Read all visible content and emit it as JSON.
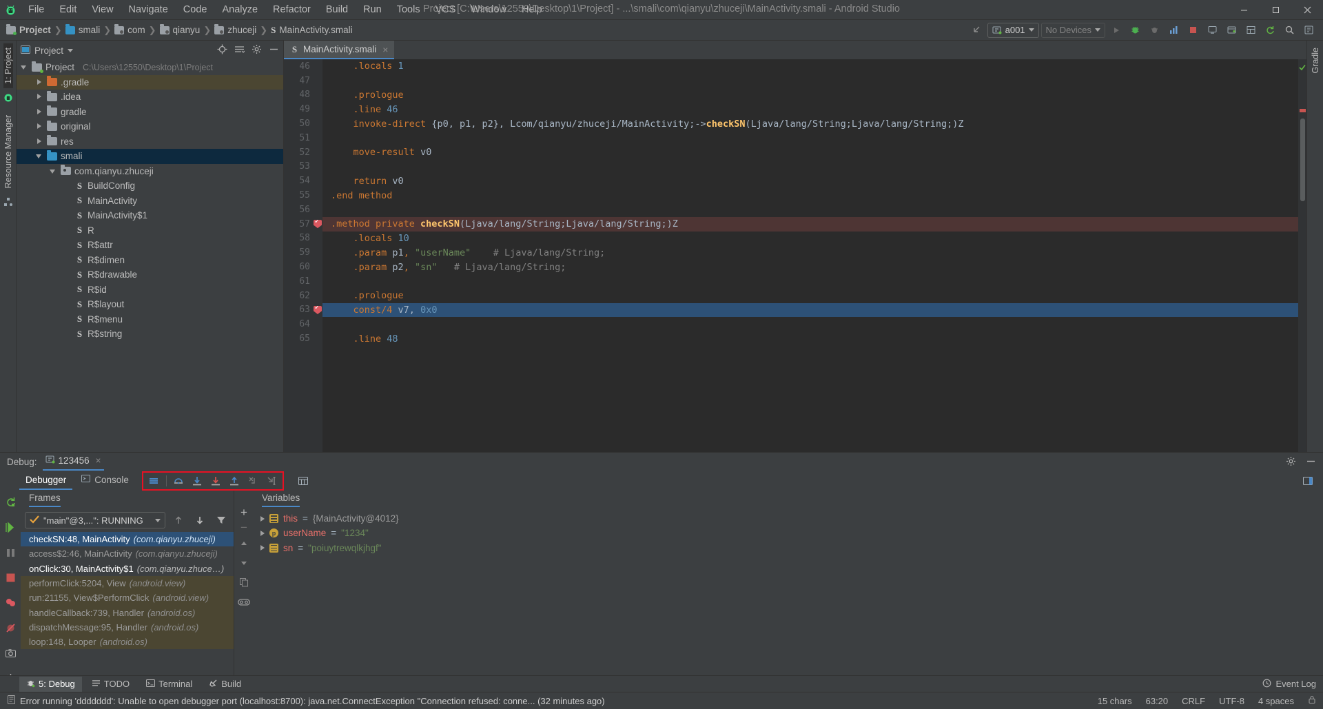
{
  "window": {
    "title": "Project [C:\\Users\\12550\\Desktop\\1\\Project] - ...\\smali\\com\\qianyu\\zhuceji\\MainActivity.smali - Android Studio",
    "minimize_label": "–",
    "maximize_label": "❐",
    "close_label": "✕"
  },
  "menu": [
    {
      "label": "File"
    },
    {
      "label": "Edit"
    },
    {
      "label": "View"
    },
    {
      "label": "Navigate"
    },
    {
      "label": "Code"
    },
    {
      "label": "Analyze"
    },
    {
      "label": "Refactor"
    },
    {
      "label": "Build"
    },
    {
      "label": "Run"
    },
    {
      "label": "Tools"
    },
    {
      "label": "VCS"
    },
    {
      "label": "Window"
    },
    {
      "label": "Help"
    }
  ],
  "breadcrumb": [
    {
      "label": "Project",
      "icon": "folder-module-icon"
    },
    {
      "label": "smali",
      "icon": "folder-blue-icon"
    },
    {
      "label": "com",
      "icon": "folder-package-icon"
    },
    {
      "label": "qianyu",
      "icon": "folder-package-icon"
    },
    {
      "label": "zhuceji",
      "icon": "folder-package-icon"
    },
    {
      "label": "MainActivity.smali",
      "icon": "smali-file-icon"
    }
  ],
  "toolbar": {
    "run_config": "a001",
    "device": "No Devices",
    "back_icon": "back-arrow-icon",
    "run_icon": "run-icon",
    "debug_icon": "debug-icon",
    "attach_icon": "attach-debugger-icon",
    "profile_icon": "profile-icon",
    "stop_icon": "stop-icon",
    "avd_icon": "avd-manager-icon",
    "sdk_icon": "sdk-manager-icon",
    "layout_icon": "layout-inspector-icon",
    "sync_icon": "sync-gradle-icon",
    "search_icon": "search-icon",
    "settings_icon": "settings-icon"
  },
  "left_rail": [
    {
      "label": "1: Project",
      "selected": true
    },
    {
      "label": "Resource Manager",
      "selected": false
    }
  ],
  "project_panel": {
    "header_title": "Project",
    "locate_icon": "locate-icon",
    "collapse_icon": "collapse-all-icon",
    "settings_icon": "gear-icon",
    "hide_icon": "hide-icon",
    "tree": [
      {
        "label": "Project",
        "path": "C:\\Users\\12550\\Desktop\\1\\Project",
        "indent": 0,
        "arrow": "down",
        "icon": "folder-module-icon",
        "state": "normal"
      },
      {
        "label": ".gradle",
        "path": "",
        "indent": 1,
        "arrow": "right",
        "icon": "folder-orange-icon",
        "state": "highlight"
      },
      {
        "label": ".idea",
        "path": "",
        "indent": 1,
        "arrow": "right",
        "icon": "folder-gray-icon",
        "state": "normal"
      },
      {
        "label": "gradle",
        "path": "",
        "indent": 1,
        "arrow": "right",
        "icon": "folder-gray-icon",
        "state": "normal"
      },
      {
        "label": "original",
        "path": "",
        "indent": 1,
        "arrow": "right",
        "icon": "folder-gray-icon",
        "state": "normal"
      },
      {
        "label": "res",
        "path": "",
        "indent": 1,
        "arrow": "right",
        "icon": "folder-gray-icon",
        "state": "normal"
      },
      {
        "label": "smali",
        "path": "",
        "indent": 1,
        "arrow": "down",
        "icon": "folder-blue-icon",
        "state": "selected"
      },
      {
        "label": "com.qianyu.zhuceji",
        "path": "",
        "indent": 2,
        "arrow": "down",
        "icon": "folder-package-icon",
        "state": "normal"
      },
      {
        "label": "BuildConfig",
        "path": "",
        "indent": 3,
        "arrow": "none",
        "icon": "smali-file-icon",
        "state": "normal"
      },
      {
        "label": "MainActivity",
        "path": "",
        "indent": 3,
        "arrow": "none",
        "icon": "smali-file-icon",
        "state": "normal"
      },
      {
        "label": "MainActivity$1",
        "path": "",
        "indent": 3,
        "arrow": "none",
        "icon": "smali-file-icon",
        "state": "normal"
      },
      {
        "label": "R",
        "path": "",
        "indent": 3,
        "arrow": "none",
        "icon": "smali-file-icon",
        "state": "normal"
      },
      {
        "label": "R$attr",
        "path": "",
        "indent": 3,
        "arrow": "none",
        "icon": "smali-file-icon",
        "state": "normal"
      },
      {
        "label": "R$dimen",
        "path": "",
        "indent": 3,
        "arrow": "none",
        "icon": "smali-file-icon",
        "state": "normal"
      },
      {
        "label": "R$drawable",
        "path": "",
        "indent": 3,
        "arrow": "none",
        "icon": "smali-file-icon",
        "state": "normal"
      },
      {
        "label": "R$id",
        "path": "",
        "indent": 3,
        "arrow": "none",
        "icon": "smali-file-icon",
        "state": "normal"
      },
      {
        "label": "R$layout",
        "path": "",
        "indent": 3,
        "arrow": "none",
        "icon": "smali-file-icon",
        "state": "normal"
      },
      {
        "label": "R$menu",
        "path": "",
        "indent": 3,
        "arrow": "none",
        "icon": "smali-file-icon",
        "state": "normal"
      },
      {
        "label": "R$string",
        "path": "",
        "indent": 3,
        "arrow": "none",
        "icon": "smali-file-icon",
        "state": "normal"
      }
    ]
  },
  "editor": {
    "tab_label": "MainActivity.smali",
    "tab_close": "×",
    "lines": [
      {
        "n": "46",
        "bp": false,
        "state": "normal",
        "tokens": [
          {
            "t": "    ",
            "c": "id"
          },
          {
            "t": ".locals ",
            "c": "k"
          },
          {
            "t": "1",
            "c": "num"
          }
        ]
      },
      {
        "n": "47",
        "bp": false,
        "state": "normal",
        "tokens": []
      },
      {
        "n": "48",
        "bp": false,
        "state": "normal",
        "tokens": [
          {
            "t": "    ",
            "c": "id"
          },
          {
            "t": ".prologue",
            "c": "k"
          }
        ]
      },
      {
        "n": "49",
        "bp": false,
        "state": "normal",
        "tokens": [
          {
            "t": "    ",
            "c": "id"
          },
          {
            "t": ".line ",
            "c": "k"
          },
          {
            "t": "46",
            "c": "num"
          }
        ]
      },
      {
        "n": "50",
        "bp": false,
        "state": "normal",
        "tokens": [
          {
            "t": "    ",
            "c": "id"
          },
          {
            "t": "invoke-direct ",
            "c": "k"
          },
          {
            "t": "{p0, p1, p2}, ",
            "c": "id"
          },
          {
            "t": "Lcom/qianyu/zhuceji/MainActivity;->",
            "c": "id"
          },
          {
            "t": "checkSN",
            "c": "mth"
          },
          {
            "t": "(Ljava/lang/String;Ljava/lang/String;)Z",
            "c": "id"
          }
        ]
      },
      {
        "n": "51",
        "bp": false,
        "state": "normal",
        "tokens": []
      },
      {
        "n": "52",
        "bp": false,
        "state": "normal",
        "tokens": [
          {
            "t": "    ",
            "c": "id"
          },
          {
            "t": "move-result ",
            "c": "k"
          },
          {
            "t": "v0",
            "c": "id"
          }
        ]
      },
      {
        "n": "53",
        "bp": false,
        "state": "normal",
        "tokens": []
      },
      {
        "n": "54",
        "bp": false,
        "state": "normal",
        "tokens": [
          {
            "t": "    ",
            "c": "id"
          },
          {
            "t": "return ",
            "c": "k"
          },
          {
            "t": "v0",
            "c": "id"
          }
        ]
      },
      {
        "n": "55",
        "bp": false,
        "state": "normal",
        "tokens": [
          {
            "t": ".end method",
            "c": "k"
          }
        ]
      },
      {
        "n": "56",
        "bp": false,
        "state": "normal",
        "tokens": []
      },
      {
        "n": "57",
        "bp": true,
        "state": "err",
        "tokens": [
          {
            "t": ".method private ",
            "c": "k"
          },
          {
            "t": "checkSN",
            "c": "mth"
          },
          {
            "t": "(Ljava/lang/String;Ljava/lang/String;)Z",
            "c": "id"
          }
        ]
      },
      {
        "n": "58",
        "bp": false,
        "state": "normal",
        "tokens": [
          {
            "t": "    ",
            "c": "id"
          },
          {
            "t": ".locals ",
            "c": "k"
          },
          {
            "t": "10",
            "c": "num"
          }
        ]
      },
      {
        "n": "59",
        "bp": false,
        "state": "normal",
        "tokens": [
          {
            "t": "    ",
            "c": "id"
          },
          {
            "t": ".param ",
            "c": "k"
          },
          {
            "t": "p1",
            "c": "id"
          },
          {
            "t": ", ",
            "c": "k"
          },
          {
            "t": "\"userName\"",
            "c": "str"
          },
          {
            "t": "    # Ljava/lang/String;",
            "c": "cmt"
          }
        ]
      },
      {
        "n": "60",
        "bp": false,
        "state": "normal",
        "tokens": [
          {
            "t": "    ",
            "c": "id"
          },
          {
            "t": ".param ",
            "c": "k"
          },
          {
            "t": "p2",
            "c": "id"
          },
          {
            "t": ", ",
            "c": "k"
          },
          {
            "t": "\"sn\"",
            "c": "str"
          },
          {
            "t": "   # Ljava/lang/String;",
            "c": "cmt"
          }
        ]
      },
      {
        "n": "61",
        "bp": false,
        "state": "normal",
        "tokens": []
      },
      {
        "n": "62",
        "bp": false,
        "state": "normal",
        "tokens": [
          {
            "t": "    ",
            "c": "id"
          },
          {
            "t": ".prologue",
            "c": "k"
          }
        ]
      },
      {
        "n": "63",
        "bp": true,
        "state": "cur",
        "tokens": [
          {
            "t": "    ",
            "c": "id"
          },
          {
            "t": "const/4 ",
            "c": "k"
          },
          {
            "t": "v7, ",
            "c": "id"
          },
          {
            "t": "0x0",
            "c": "num"
          }
        ]
      },
      {
        "n": "64",
        "bp": false,
        "state": "normal",
        "tokens": []
      },
      {
        "n": "65",
        "bp": false,
        "state": "normal",
        "tokens": [
          {
            "t": "    ",
            "c": "id"
          },
          {
            "t": ".line ",
            "c": "k"
          },
          {
            "t": "48",
            "c": "num"
          }
        ]
      }
    ]
  },
  "right_rail": [
    {
      "label": "Gradle"
    }
  ],
  "debug": {
    "title": "Debug:",
    "session_name": "123456",
    "session_close": "×",
    "session_icon": "run-config-icon",
    "settings_icon": "gear-icon",
    "hide_icon": "hide-icon",
    "restore_icon": "restore-layout-icon",
    "rerun_icon": "rerun-icon",
    "tabs": [
      {
        "label": "Debugger",
        "active": true,
        "icon": ""
      },
      {
        "label": "Console",
        "active": false,
        "icon": "console-icon"
      }
    ],
    "step_buttons": [
      {
        "name": "show-execution-point-icon",
        "tip": "Show Execution Point"
      },
      {
        "name": "step-over-icon",
        "tip": "Step Over"
      },
      {
        "name": "step-into-icon",
        "tip": "Step Into"
      },
      {
        "name": "force-step-into-icon",
        "tip": "Force Step Into"
      },
      {
        "name": "step-out-icon",
        "tip": "Step Out"
      },
      {
        "name": "drop-frame-icon",
        "tip": "Drop Frame"
      },
      {
        "name": "run-to-cursor-icon",
        "tip": "Run to Cursor"
      }
    ],
    "evaluate_icon": "evaluate-expression-icon",
    "frames": {
      "tab_label": "Frames",
      "thread": "\"main\"@3,...\": RUNNING",
      "thread_state_icon": "thread-running-icon",
      "up_icon": "frame-up-icon",
      "down_icon": "frame-down-icon",
      "filter_icon": "filter-icon",
      "items": [
        {
          "label": "checkSN:48, MainActivity",
          "pkg": "(com.qianyu.zhuceji)",
          "state": "selected"
        },
        {
          "label": "access$2:46, MainActivity",
          "pkg": "(com.qianyu.zhuceji)",
          "state": "normal"
        },
        {
          "label": "onClick:30, MainActivity$1",
          "pkg": "(com.qianyu.zhuce…)",
          "state": "active"
        },
        {
          "label": "performClick:5204, View",
          "pkg": "(android.view)",
          "state": "lib"
        },
        {
          "label": "run:21155, View$PerformClick",
          "pkg": "(android.view)",
          "state": "lib"
        },
        {
          "label": "handleCallback:739, Handler",
          "pkg": "(android.os)",
          "state": "lib"
        },
        {
          "label": "dispatchMessage:95, Handler",
          "pkg": "(android.os)",
          "state": "lib"
        },
        {
          "label": "loop:148, Looper",
          "pkg": "(android.os)",
          "state": "lib"
        }
      ]
    },
    "variables": {
      "tab_label": "Variables",
      "add_icon": "add-watch-icon",
      "remove_icon": "remove-watch-icon",
      "copy_icon": "copy-value-icon",
      "inspect_icon": "inspect-icon",
      "items": [
        {
          "name": "this",
          "eq": " = ",
          "value": "{MainActivity@4012}",
          "kind": "object",
          "icon": "field-icon"
        },
        {
          "name": "userName",
          "eq": " = ",
          "value": "\"1234\"",
          "kind": "string",
          "icon": "parameter-icon"
        },
        {
          "name": "sn",
          "eq": " = ",
          "value": "\"poiuytrewqlkjhgf\"",
          "kind": "string",
          "icon": "field-icon"
        }
      ]
    }
  },
  "tool_windows": [
    {
      "label": "5: Debug",
      "icon": "debug-icon",
      "active": true
    },
    {
      "label": "TODO",
      "icon": "todo-icon",
      "active": false
    },
    {
      "label": "Terminal",
      "icon": "terminal-icon",
      "active": false
    },
    {
      "label": "Build",
      "icon": "build-icon",
      "active": false
    }
  ],
  "status": {
    "message": "Error running 'ddddddd': Unable to open debugger port (localhost:8700): java.net.ConnectException \"Connection refused: conne... (32 minutes ago)",
    "message_icon": "event-log-icon",
    "chars": "15 chars",
    "caret": "63:20",
    "line_sep": "CRLF",
    "encoding": "UTF-8",
    "indent": "4 spaces",
    "event_log": "Event Log",
    "event_log_icon": "event-log-icon"
  },
  "colors": {
    "accent": "#4a88c7",
    "selection": "#2d5177",
    "error_line": "#4e3534",
    "breakpoint": "#db5860",
    "annotation_box": "#e81123",
    "tree_selected": "#0d293e"
  }
}
